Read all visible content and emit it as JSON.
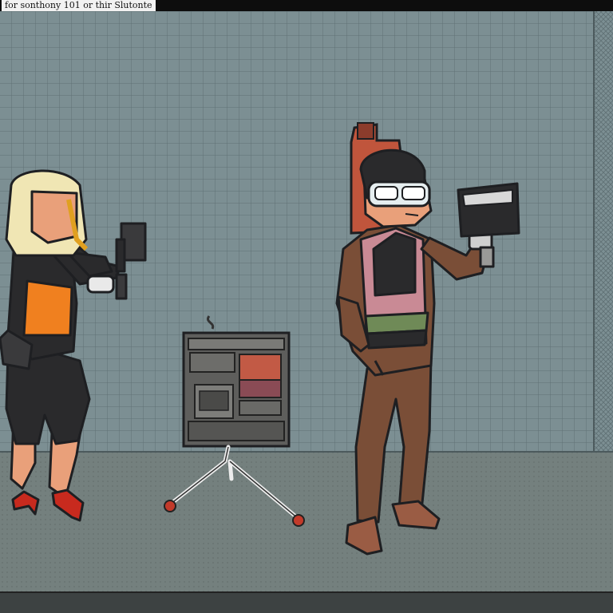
{
  "caption": {
    "text": "for sonthony 101 or thir Slutonte"
  },
  "scene": {
    "colors": {
      "wall": "#7c8f93",
      "floor": "#74807e",
      "grid_line": "#5f7074",
      "outline": "#1e1f22",
      "skin": "#e9a07a",
      "hair_blonde": "#f0e6b4",
      "orange_top": "#f0801f",
      "brown_jacket": "#7a4e37",
      "pink_vest": "#c98a95",
      "green_band": "#6f8a57",
      "monitor_body": "#5e5e5c",
      "monitor_red": "#c25a45"
    },
    "figures": [
      "blonde-woman-with-camera",
      "man-with-goggles-holding-tablet"
    ],
    "objects": [
      "monitor-on-tripod",
      "wall-mounted-box"
    ]
  }
}
